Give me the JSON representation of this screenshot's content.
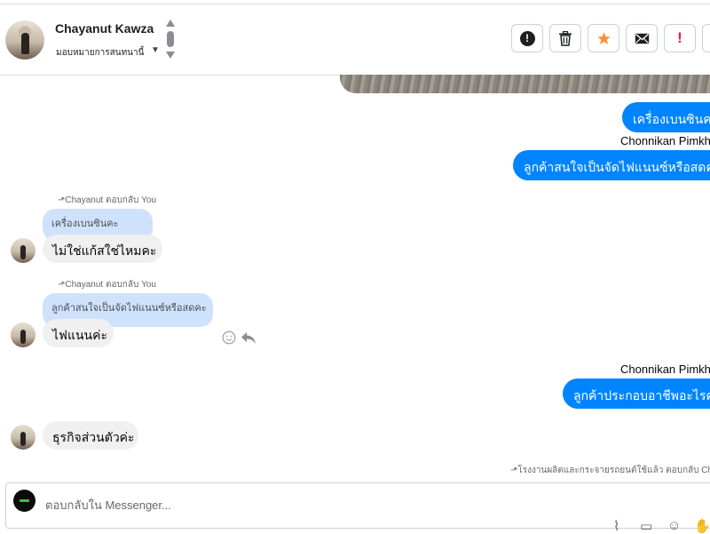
{
  "header": {
    "contact_name": "Chayanut Kawza",
    "status": "มอบหมายการสนทนานี้",
    "actions": [
      {
        "name": "report",
        "icon": "exclamation-circle-icon"
      },
      {
        "name": "delete",
        "icon": "trash-icon"
      },
      {
        "name": "star",
        "icon": "star-icon",
        "color": "#f7923b"
      },
      {
        "name": "mark-unread",
        "icon": "envelope-icon"
      },
      {
        "name": "spam",
        "icon": "exclamation-icon",
        "color": "#e41e3f"
      },
      {
        "name": "more",
        "icon": "partial-button"
      }
    ]
  },
  "messages": {
    "out1": "เครื่องเบนซินคะ",
    "sender_out": "Chonnikan Pimkha",
    "out2": "ลูกค้าสนใจเป็นจัดไฟแนนซ์หรือสดคะ",
    "reply1_meta": "Chayanut ตอบกลับ You",
    "reply1_quote": "เครื่องเบนซินคะ",
    "in1": "ไม่ใช่แก้สใช่ไหมคะ",
    "reply2_meta": "Chayanut ตอบกลับ You",
    "reply2_quote": "ลูกค้าสนใจเป็นจัดไฟแนนซ์หรือสดคะ",
    "in2": "ไฟแนนค่ะ",
    "sender_out2": "Chonnikan Pimkha",
    "out3": "ลูกค้าประกอบอาชีพอะไรคะ",
    "in3": "ธุรกิจส่วนตัวค่ะ",
    "reply3_meta": "โรงงานผลิตและกระจายรถยนต์ใช้แล้ว ตอบกลับ Chaya"
  },
  "composer": {
    "placeholder": "ตอบกลับใน Messenger..."
  },
  "colors": {
    "outgoing_bubble": "#0084ff",
    "incoming_bubble": "#f0f0f0",
    "quote_bubble": "#cfe2fb"
  }
}
